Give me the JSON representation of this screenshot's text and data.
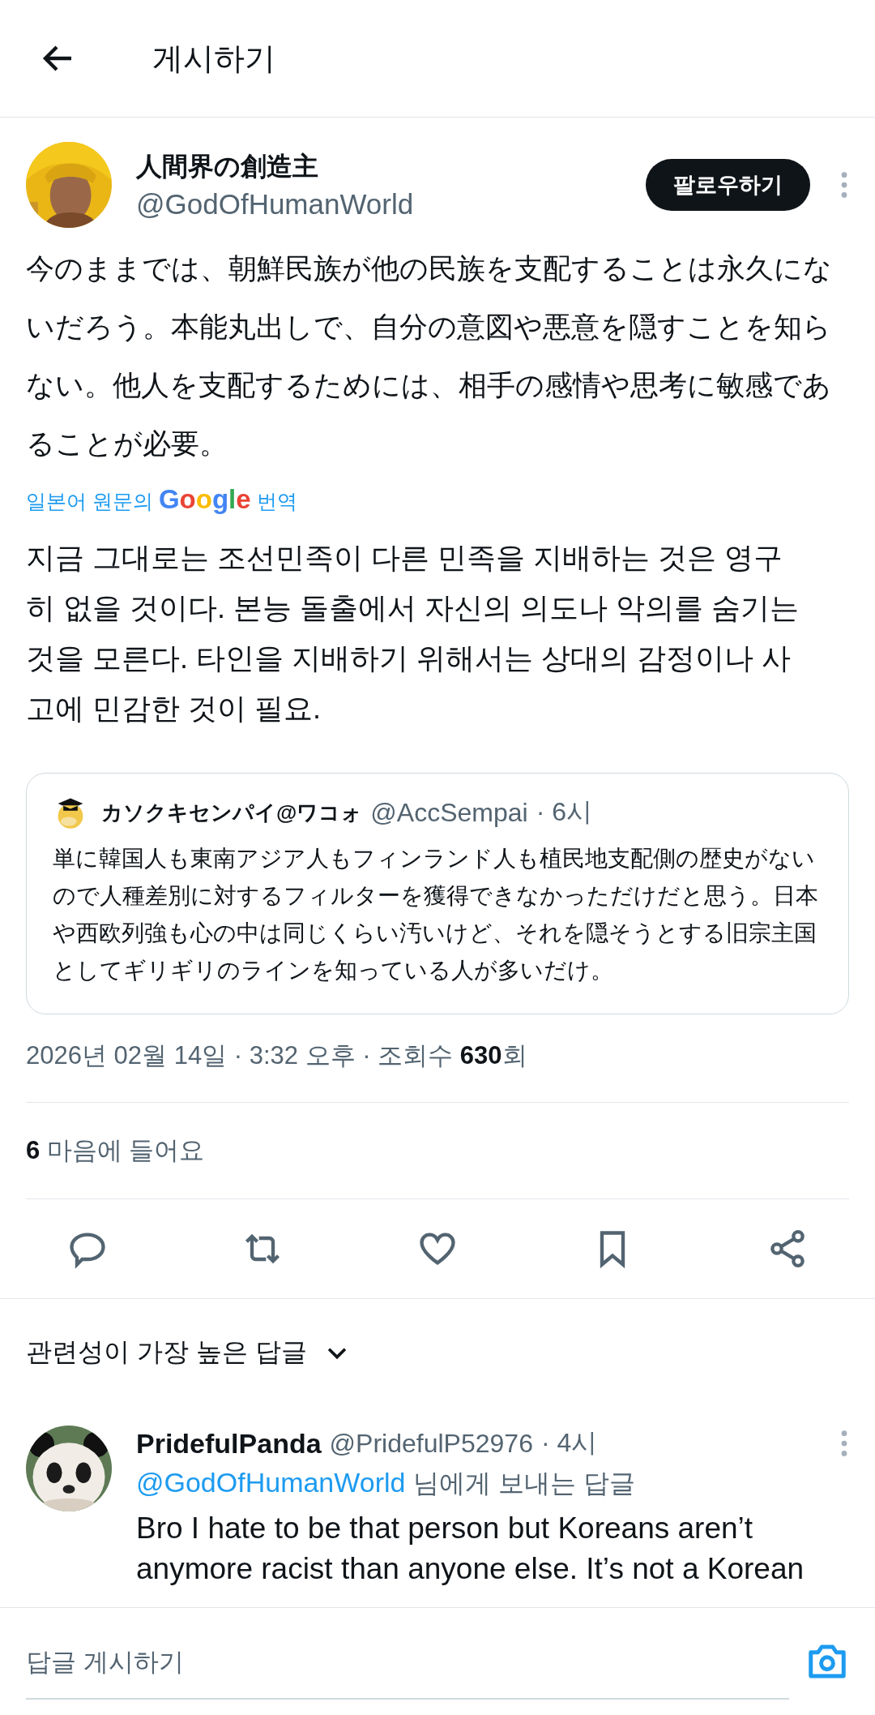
{
  "header": {
    "title": "게시하기"
  },
  "post": {
    "author": {
      "name": "人間界の創造主",
      "handle": "@GodOfHumanWorld"
    },
    "follow_button": "팔로우하기",
    "text": "今のままでは、朝鮮民族が他の民族を支配することは永久にないだろう。本能丸出しで、自分の意図や悪意を隠すことを知らない。他人を支配するためには、相手の感情や思考に敏感であることが必要。",
    "translation_link": {
      "prefix": "일본어 원문의",
      "brand": "Google",
      "suffix": "번역"
    },
    "translated_text": "지금 그대로는 조선민족이 다른 민족을 지배하는 것은 영구히 없을 것이다. 본능 돌출에서 자신의 의도나 악의를 숨기는 것을 모른다. 타인을 지배하기 위해서는 상대의 감정이나 사고에 민감한 것이 필요.",
    "quote": {
      "name": "カソクキセンパイ@ワコォ",
      "handle": "@AccSempai",
      "time": "· 6시",
      "text": "単に韓国人も東南アジア人もフィンランド人も植民地支配側の歴史がないので人種差別に対するフィルターを獲得できなかっただけだと思う。日本や西欧列強も心の中は同じくらい汚いけど、それを隠そうとする旧宗主国としてギリギリのラインを知っている人が多いだけ。"
    },
    "meta": "2026년 02월 14일 · 3:32 오후 · 조회수 **630**회",
    "likes": "**6** 마음에 들어요",
    "actions": [
      {
        "kind": "reply"
      },
      {
        "kind": "repost"
      },
      {
        "kind": "like"
      },
      {
        "kind": "bookmark"
      },
      {
        "kind": "share"
      }
    ]
  },
  "replies_sort": "관련성이 가장 높은 답글",
  "replies": [
    {
      "name": "PridefulPanda",
      "handle": "@PridefulP52976",
      "time": "· 4시",
      "mention": "@GodOfHumanWorld",
      "mention_suffix": "님에게 보내는 답글",
      "text": "Bro I hate to be that person but Koreans aren’t anymore racist than anyone else. It’s not a Korean"
    }
  ],
  "composer": {
    "placeholder": "답글 게시하기"
  }
}
